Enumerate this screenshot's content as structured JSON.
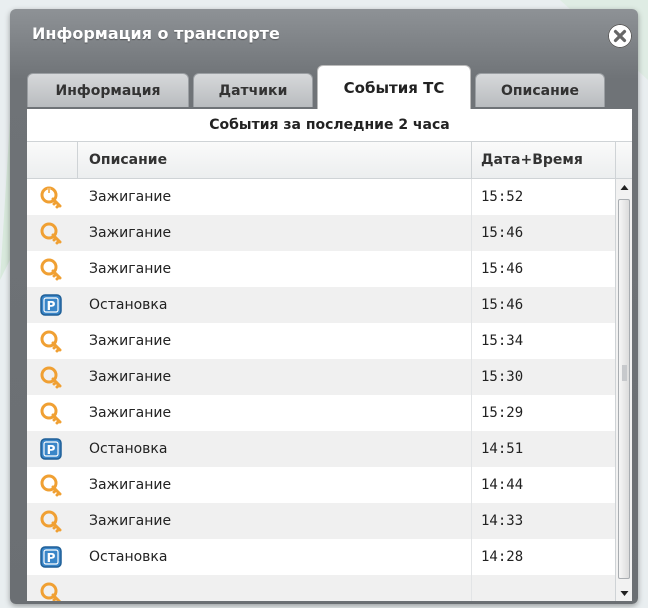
{
  "window": {
    "title": "Информация о транспорте"
  },
  "tabs": [
    {
      "label": "Информация"
    },
    {
      "label": "Датчики"
    },
    {
      "label": "События ТС"
    },
    {
      "label": "Описание"
    }
  ],
  "active_tab": "События ТС",
  "panel": {
    "subtitle": "События за последние 2 часа"
  },
  "table": {
    "headers": {
      "description": "Описание",
      "datetime": "Дата+Время"
    },
    "rows": [
      {
        "icon": "ignition-key-icon",
        "description": "Зажигание",
        "time": "15:52"
      },
      {
        "icon": "ignition-key-icon",
        "description": "Зажигание",
        "time": "15:46"
      },
      {
        "icon": "ignition-key-icon",
        "description": "Зажигание",
        "time": "15:46"
      },
      {
        "icon": "parking-icon",
        "description": "Остановка",
        "time": "15:46"
      },
      {
        "icon": "ignition-key-icon",
        "description": "Зажигание",
        "time": "15:34"
      },
      {
        "icon": "ignition-key-icon",
        "description": "Зажигание",
        "time": "15:30"
      },
      {
        "icon": "ignition-key-icon",
        "description": "Зажигание",
        "time": "15:29"
      },
      {
        "icon": "parking-icon",
        "description": "Остановка",
        "time": "14:51"
      },
      {
        "icon": "ignition-key-icon",
        "description": "Зажигание",
        "time": "14:44"
      },
      {
        "icon": "ignition-key-icon",
        "description": "Зажигание",
        "time": "14:33"
      },
      {
        "icon": "parking-icon",
        "description": "Остановка",
        "time": "14:28"
      },
      {
        "icon": "ignition-key-icon",
        "description": "",
        "time": ""
      }
    ]
  },
  "colors": {
    "accent_orange": "#f0a033",
    "parking_blue": "#3a86c8",
    "window_gray": "#7a7e82"
  }
}
